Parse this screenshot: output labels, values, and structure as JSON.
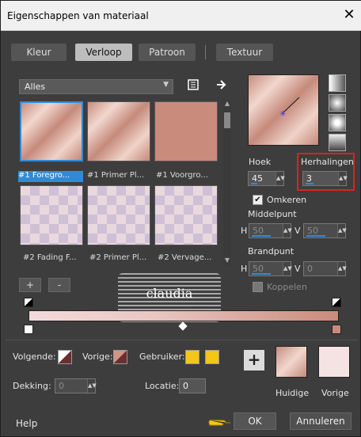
{
  "window": {
    "title": "Eigenschappen van materiaal",
    "close_glyph": "✕"
  },
  "tabs": [
    {
      "label": "Kleur",
      "active": false
    },
    {
      "label": "Verloop",
      "active": true
    },
    {
      "label": "Patroon",
      "active": false
    },
    {
      "label": "Textuur",
      "active": false
    }
  ],
  "library": {
    "category": "Alles",
    "items": [
      {
        "label": "#1 Foregro...",
        "style": "gradient",
        "selected": true
      },
      {
        "label": "#1 Primer Pl...",
        "style": "gradient",
        "selected": false
      },
      {
        "label": "#1 Voorgro...",
        "style": "solid",
        "selected": false
      },
      {
        "label": "#2 Fading F...",
        "style": "checker",
        "selected": false
      },
      {
        "label": "#2 Primer Pl...",
        "style": "checker",
        "selected": false
      },
      {
        "label": "#2 Vervage...",
        "style": "checker",
        "selected": false
      }
    ]
  },
  "icons": {
    "book": "book-icon",
    "arrow": "arrow-right-icon"
  },
  "settings": {
    "hoek_label": "Hoek",
    "hoek_value": "45",
    "herhalingen_label": "Herhalingen",
    "herhalingen_value": "3",
    "omkeren_label": "Omkeren",
    "omkeren_checked": true,
    "middelpunt_label": "Middelpunt",
    "brandpunt_label": "Brandpunt",
    "h_label": "H",
    "v_label": "V",
    "mid_h": "50",
    "mid_v": "50",
    "brand_h": "50",
    "brand_v": "0",
    "koppelen_label": "Koppelen",
    "koppelen_checked": false
  },
  "editor": {
    "add_label": "+",
    "remove_label": "-",
    "watermark_text": "claudia"
  },
  "footer": {
    "volgende_label": "Volgende:",
    "vorige_label": "Vorige:",
    "gebruiker_label": "Gebruiker:",
    "dekking_label": "Dekking:",
    "dekking_value": "0",
    "locatie_label": "Locatie:",
    "locatie_value": "0",
    "huidige_label": "Huidige",
    "vorige_swatch_label": "Vorige",
    "help_label": "Help",
    "ok_label": "OK",
    "annuleren_label": "Annuleren"
  },
  "colors": {
    "accent": "#2f8bd8",
    "highlight": "#e02020",
    "gebruiker": "#f5c518",
    "gradient_dark": "#c98b7c",
    "gradient_light": "#f3dada"
  }
}
